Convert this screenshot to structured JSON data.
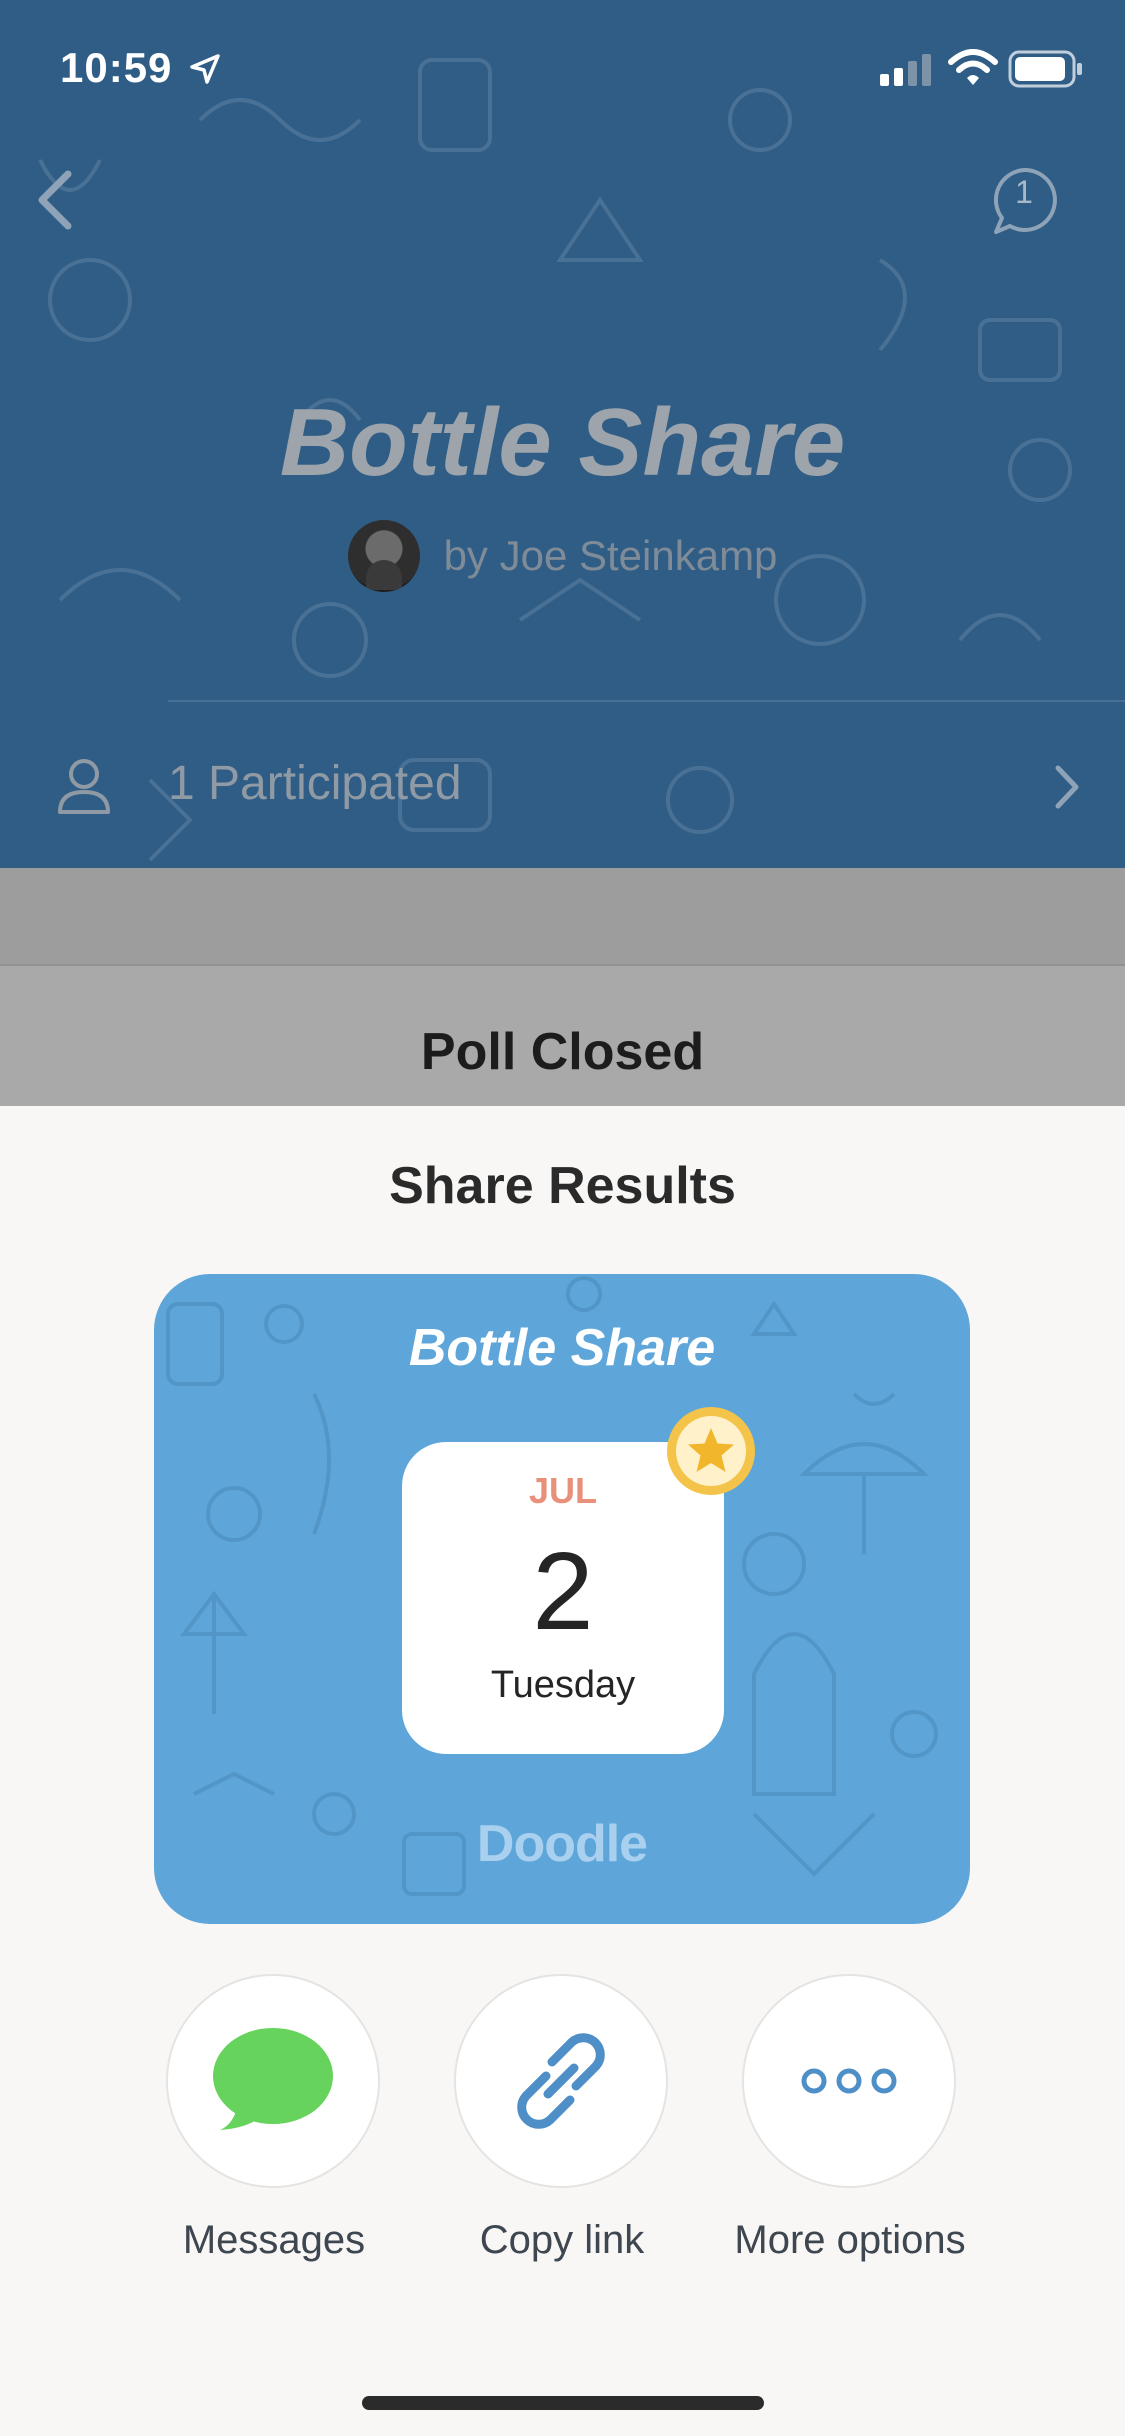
{
  "status_bar": {
    "time": "10:59",
    "location_icon": "location-arrow-icon",
    "signal_icon": "cellular-signal-icon",
    "wifi_icon": "wifi-icon",
    "battery_icon": "battery-icon"
  },
  "header": {
    "back_icon": "chevron-left-icon",
    "comments_count": "1",
    "comments_icon": "comment-bubble-icon",
    "poll_title": "Bottle Share",
    "author": "by Joe Steinkamp",
    "participants_label": "1 Participated",
    "participants_icon": "person-icon",
    "participants_chevron": "chevron-right-icon"
  },
  "poll_status": "Poll Closed",
  "sheet": {
    "title": "Share Results",
    "card": {
      "title": "Bottle Share",
      "month": "JUL",
      "day": "2",
      "weekday": "Tuesday",
      "badge_icon": "star-icon",
      "brand": "Doodle"
    },
    "options": [
      {
        "label": "Messages",
        "icon": "messages-bubble-icon"
      },
      {
        "label": "Copy link",
        "icon": "link-icon"
      },
      {
        "label": "More options",
        "icon": "more-dots-icon"
      }
    ]
  },
  "colors": {
    "header_bg": "#2f5d86",
    "card_bg": "#5ea6da",
    "sheet_bg": "#f8f7f5",
    "messages_green": "#66d35c",
    "link_blue": "#4f8fc7",
    "badge_yellow": "#f3c34a",
    "month_accent": "#e8907a"
  }
}
